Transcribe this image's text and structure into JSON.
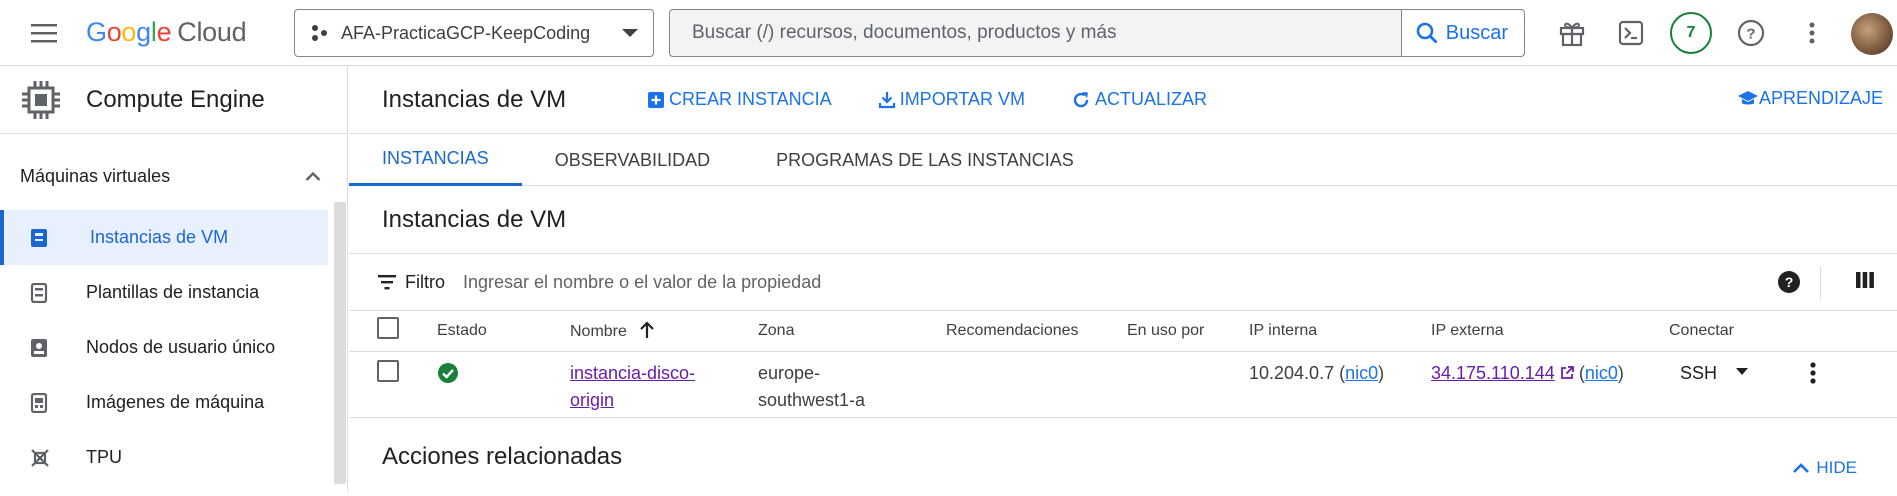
{
  "topbar": {
    "logo_google": "Google",
    "logo_cloud": "Cloud",
    "project": "AFA-PracticaGCP-KeepCoding",
    "search_placeholder": "Buscar (/) recursos, documentos, productos y más",
    "search_button": "Buscar",
    "notifications_count": "7"
  },
  "sidebar": {
    "product": "Compute Engine",
    "section": "Máquinas virtuales",
    "items": [
      {
        "label": "Instancias de VM",
        "icon": "vm-instances-icon",
        "active": true
      },
      {
        "label": "Plantillas de instancia",
        "icon": "instance-template-icon",
        "active": false
      },
      {
        "label": "Nodos de usuario único",
        "icon": "sole-tenant-icon",
        "active": false
      },
      {
        "label": "Imágenes de máquina",
        "icon": "machine-image-icon",
        "active": false
      },
      {
        "label": "TPU",
        "icon": "tpu-icon",
        "active": false
      }
    ]
  },
  "page": {
    "title": "Instancias de VM",
    "actions": {
      "create": "CREAR INSTANCIA",
      "import": "IMPORTAR VM",
      "refresh": "ACTUALIZAR",
      "learn": "APRENDIZAJE"
    },
    "tabs": [
      "INSTANCIAS",
      "OBSERVABILIDAD",
      "PROGRAMAS DE LAS INSTANCIAS"
    ],
    "section_title": "Instancias de VM",
    "filter_label": "Filtro",
    "filter_placeholder": "Ingresar el nombre o el valor de la propiedad"
  },
  "table": {
    "columns": [
      "Estado",
      "Nombre",
      "Zona",
      "Recomendaciones",
      "En uso por",
      "IP interna",
      "IP externa",
      "Conectar"
    ],
    "rows": [
      {
        "status": "running",
        "name_line1": "instancia-disco-",
        "name_line2": "origin",
        "zone_line1": "europe-",
        "zone_line2": "southwest1-a",
        "recommendations": "",
        "in_use_by": "",
        "internal_ip": "10.204.0.7",
        "internal_nic": "nic0",
        "external_ip": "34.175.110.144",
        "external_nic": "nic0",
        "connect": "SSH"
      }
    ]
  },
  "related": {
    "title": "Acciones relacionadas",
    "hide": "HIDE"
  },
  "colors": {
    "accent": "#1a73e8",
    "active_bg": "#e8f0fe",
    "running": "#188038",
    "visited_link": "#681da8"
  }
}
